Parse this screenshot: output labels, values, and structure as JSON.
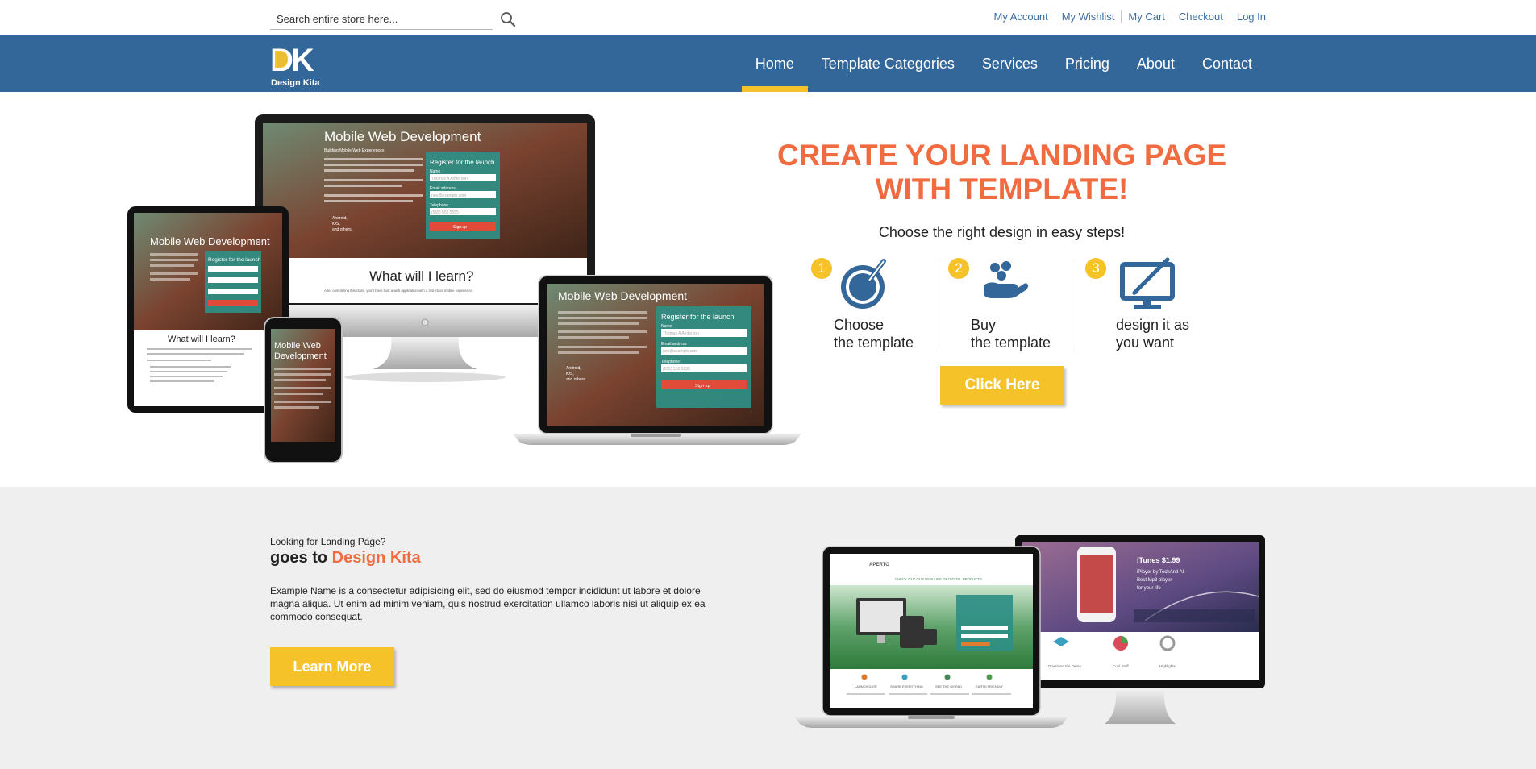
{
  "header": {
    "search": {
      "placeholder": "Search entire store here..."
    },
    "links": [
      "My Account",
      "My Wishlist",
      "My Cart",
      "Checkout",
      "Log In"
    ]
  },
  "logo": {
    "letters": "DK",
    "name": "Design Kita"
  },
  "nav": {
    "items": [
      "Home",
      "Template Categories",
      "Services",
      "Pricing",
      "About",
      "Contact"
    ],
    "active": "Home"
  },
  "hero": {
    "title_line1": "CREATE YOUR LANDING PAGE",
    "title_line2": "WITH TEMPLATE!",
    "subtitle": "Choose the right design in easy steps!",
    "steps": [
      {
        "number": "1",
        "line1": "Choose",
        "line2": "the template",
        "icon": "globe-pen-icon"
      },
      {
        "number": "2",
        "line1": "Buy",
        "line2": "the template",
        "icon": "hand-coins-icon"
      },
      {
        "number": "3",
        "line1": "design it as",
        "line2": "you want",
        "icon": "monitor-brush-icon"
      }
    ],
    "cta": "Click Here",
    "mockup": {
      "title": "Mobile Web Development",
      "tagline": "Building Mobile Web Experiences",
      "form_title": "Register for the launch",
      "name_label": "Name",
      "name_value": "Thomas A Anderson",
      "email_label": "Email address",
      "email_value": "neo@example.com",
      "phone_label": "Telephone",
      "phone_value": "(555) 555 5555",
      "signup": "Sign up",
      "learn": "What will I learn?",
      "footer_note": "After completing this class, you'll have built a web application with a first-class mobile experience.",
      "list": [
        "Android,",
        "iOS,",
        "and others."
      ]
    }
  },
  "lower": {
    "small": "Looking for Landing Page?",
    "title_prefix": "goes to ",
    "title_brand": "Design Kita",
    "text": "Example Name is a consectetur adipisicing elit, sed do eiusmod tempor incididunt ut labore et dolore magna aliqua. Ut enim ad minim veniam, quis nostrud exercitation ullamco laboris nisi ut aliquip ex ea commodo consequat.",
    "cta": "Learn More",
    "laptop_screen": {
      "brand": "APERTO",
      "banner": "CHECK OUT OUR NEW LINE OF DIGITAL PRODUCTS",
      "features": [
        "LAUNCH DATE",
        "SHARE EVERYTHING",
        "SEE THE WORLD",
        "EARTH FRIENDLY"
      ]
    },
    "monitor_screen": {
      "price": "iTunes $1.99",
      "lines": [
        "iPlayer by TechAnd All",
        "Best Mp3 player",
        "for your life"
      ],
      "features": [
        "Download the Demo",
        "Cool Stuff",
        "Highlights"
      ]
    }
  },
  "colors": {
    "nav_bg": "#336699",
    "accent_yellow": "#f6c22a",
    "accent_orange": "#f06c40",
    "link_blue": "#3a6b9e",
    "lower_bg": "#efefef"
  }
}
